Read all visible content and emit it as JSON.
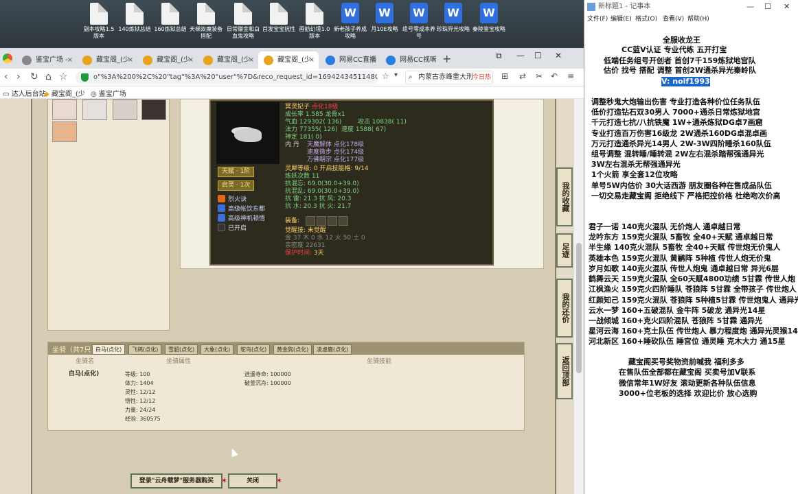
{
  "desktop": {
    "icons": [
      {
        "label": "副本攻略1.5版本",
        "type": "doc"
      },
      {
        "label": "140炼狱总结",
        "type": "doc"
      },
      {
        "label": "160炼狱总结",
        "type": "doc"
      },
      {
        "label": "天梯双魔装备搭配",
        "type": "doc"
      },
      {
        "label": "日常赚金和白血鬼攻略",
        "type": "doc"
      },
      {
        "label": "首发宝宝抗性",
        "type": "doc"
      },
      {
        "label": "画舫幻境1.0版本",
        "type": "doc"
      },
      {
        "label": "新老孩子养成攻略",
        "type": "wps"
      },
      {
        "label": "月10E攻略",
        "type": "wps"
      },
      {
        "label": "组号零成本养号",
        "type": "wps"
      },
      {
        "label": "珍珠异光攻略",
        "type": "wps"
      },
      {
        "label": "秦陵鉴宝攻略",
        "type": "wps"
      }
    ]
  },
  "browser": {
    "tabs": [
      {
        "label": "鉴宝广场 -",
        "active": false,
        "color": "#888"
      },
      {
        "label": "藏宝阁_(少",
        "active": false,
        "color": "#e8a21c"
      },
      {
        "label": "藏宝阁_(少",
        "active": false,
        "color": "#e8a21c"
      },
      {
        "label": "藏宝阁_(少",
        "active": false,
        "color": "#e8a21c"
      },
      {
        "label": "藏宝阁_(少",
        "active": true,
        "color": "#e8a21c"
      },
      {
        "label": "网易CC直播",
        "active": false,
        "color": "#2a7de1"
      },
      {
        "label": "网易CC视听",
        "active": false,
        "color": "#2a7de1"
      }
    ],
    "url": "o\"%3A%200%2C%20\"tag\"%3A%20\"user\"%7D&reco_request_id=1694243451148GcEr8",
    "search_text": "内蒙古赤峰重大刑",
    "search_hot": "今日热",
    "bookmarks": [
      "达人后台站",
      "藏宝阁_(少",
      "鉴宝广场"
    ]
  },
  "pet": {
    "name": "冥灵妃子",
    "name_suffix": "点化18级",
    "growth": "成长率 1.585 龙骨x1",
    "hp": "气血 129302( 136)",
    "attack": "攻击 10838( 11)",
    "mp": "法力 77355( 126)",
    "speed": "速度 1588( 67)",
    "shen": "神定 181( 0)",
    "dan_label": "内  丹",
    "dan1": "天魔解体 点化178级",
    "dan2": "速度微步 点化174级",
    "dan3": "万佛朝宗 点化177级",
    "lingxi": "灵犀等级:  0 开启技能格:  9/14",
    "lianyao": "炼妖次数 11",
    "kang1": "抗混忘: 69.0(30.0+39.0)",
    "kang2": "抗混乱: 69.0(30.0+39.0)",
    "kang3": "抗  雷: 21.3  抗   风: 20.3",
    "kang4": "抗  水: 20.3  抗   火: 21.7",
    "tianfu": "天赋 · 1阶",
    "qiling": "启灵 · 1次",
    "skills": [
      {
        "name": "烈火诀",
        "color": "#e3661b"
      },
      {
        "name": "高级帐饮东都",
        "color": "#3b6fd8"
      },
      {
        "name": "高级神机顿悟",
        "color": "#3b6fd8"
      },
      {
        "name": "已开启",
        "color": "#333"
      }
    ],
    "equip_label": "装备:",
    "awaken": "觉醒技:  未觉醒",
    "wuxing": "金 37 木  0  水 12  火 50  土  0",
    "qinmi": "亲密度 22631",
    "protect": "保护时间:",
    "protect_val": "3天"
  },
  "mount": {
    "title": "坐骑（共7只",
    "tabs": [
      "白马(点化)",
      "飞鸽(点化)",
      "雪貂(点化)",
      "大象(点化)",
      "鸵鸟(点化)",
      "黄金狗(点化)",
      "凌虚鹿(点化)"
    ],
    "headers": [
      "坐骑名",
      "坐骑属性",
      "坐骑技能"
    ],
    "name": "白马(点化)",
    "attrs": [
      "等级: 100",
      "体力: 1404",
      "灵性: 12/12",
      "悟性: 12/12",
      "力量: 24/24",
      "经验: 360575"
    ],
    "skills": [
      "逍遥寺命: 100000",
      "破釜沉舟: 100000"
    ]
  },
  "buttons": {
    "login": "登录\"云舟载梦\"服务器购买",
    "close": "关闭"
  },
  "rail": {
    "fav": "我的收藏",
    "trace": "足迹",
    "bargain": "我的还价",
    "top": "返回顶部"
  },
  "notepad": {
    "title": "新标题1 - 记事本",
    "menu": [
      "文件(F)",
      "编辑(E)",
      "格式(O)",
      "查看(V)",
      "帮助(H)"
    ],
    "lines": [
      "全服收龙王",
      "CC蓝V认证 专业代练 五开打宝",
      "低端任务组号开创者        首创7千159炼狱地宫队",
      "估价 找号 搭配 调整       首创2W通杀异光秦岭队",
      "V: noif1993",
      "调整秒鬼大炮输出伤害         专业打造各种价位任务队伍",
      "低价打造钻石双30男人          7000+通杀日常炼狱地宫",
      "千元打造七抗/八抗铁魔          1W+通杀炼狱DG卓7画窟",
      "专业打造百万伤害16级龙       2W通杀160DG卓混卓画",
      "万元打造通杀异光14男人       2W-3W四阶睡杀160队伍",
      "组号调整 混转睡/睡转混         2W左右混杀踏帮强通异光",
      "                                        3W左右混杀无帮强通异光",
      "1个火箭 享全套12位攻略",
      "单号5W内估价 30大话西游      朋友圈各种在售成品队伍",
      "一切交易走藏宝阁 拒绝线下     严格把控价格 杜绝吻次价高",
      "君子一诺 140克火混队 无价炮人 通卓越日常",
      "龙吟东方 159克火混队 5畜牧 全40+天赋 通卓越日常",
      "半生缘    140克火混队 5畜牧 全40+天赋 传世炮无价鬼人",
      "英雄本色 159克火混队 黄鹂阵 5种植 传世人炮无价鬼",
      "岁月如歌 140克火混队 传世人炮鬼 通卓越日常 异光6层",
      "鹤舞云天 159克火混队 全60天赋4800功绩 5甘霖 传世人炮",
      "江枫渔火 159克火四阶睡队 苍狼阵 5甘霖 全带孩子 传世炮人",
      "红颜知己 159克火混队 苍狼阵 5种植5甘霖 传世炮鬼人 通异光",
      "云水一梦 160+五破混队 金牛阵 5破龙 通异光14星",
      "一战倾城 160+克火四阶混队 苍狼阵 5甘霖 通异光",
      "星河云海 160+克土队伍 传世炮人 暴力程度炮 通异光灵猴14",
      "河北新区 160+睡砍队伍 睡宫位 通灵睡 克木大力 通15星",
      "藏宝阁买号奖物资前喊我 福利多多",
      "在售队伍全部都在藏宝阁 买卖号加V联系",
      "微信常年1W好友 滚动更新各种队伍信息",
      "3000+位老板的选择 欢迎比价 放心选购"
    ]
  }
}
